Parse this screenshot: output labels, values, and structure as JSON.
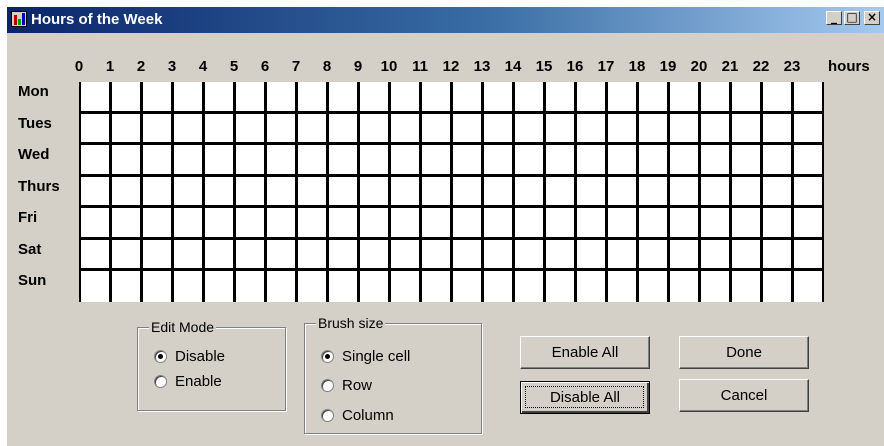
{
  "window": {
    "title": "Hours of the Week",
    "minimize_glyph": "_",
    "maximize_glyph": "□",
    "close_glyph": "×"
  },
  "grid": {
    "hours": [
      "0",
      "1",
      "2",
      "3",
      "4",
      "5",
      "6",
      "7",
      "8",
      "9",
      "10",
      "11",
      "12",
      "13",
      "14",
      "15",
      "16",
      "17",
      "18",
      "19",
      "20",
      "21",
      "22",
      "23"
    ],
    "hours_unit_label": "hours",
    "days": [
      "Mon",
      "Tues",
      "Wed",
      "Thurs",
      "Fri",
      "Sat",
      "Sun"
    ]
  },
  "edit_mode": {
    "title": "Edit Mode",
    "options": [
      {
        "label": "Disable",
        "selected": true
      },
      {
        "label": "Enable",
        "selected": false
      }
    ]
  },
  "brush_size": {
    "title": "Brush size",
    "options": [
      {
        "label": "Single cell",
        "selected": true
      },
      {
        "label": "Row",
        "selected": false
      },
      {
        "label": "Column",
        "selected": false
      }
    ]
  },
  "buttons": {
    "enable_all": "Enable All",
    "disable_all": "Disable All",
    "done": "Done",
    "cancel": "Cancel"
  },
  "colors": {
    "face": "#d4d0c8",
    "titlebar_start": "#0a246a",
    "titlebar_end": "#a6caf0",
    "grid_line": "#000000",
    "grid_cell": "#ffffff"
  }
}
